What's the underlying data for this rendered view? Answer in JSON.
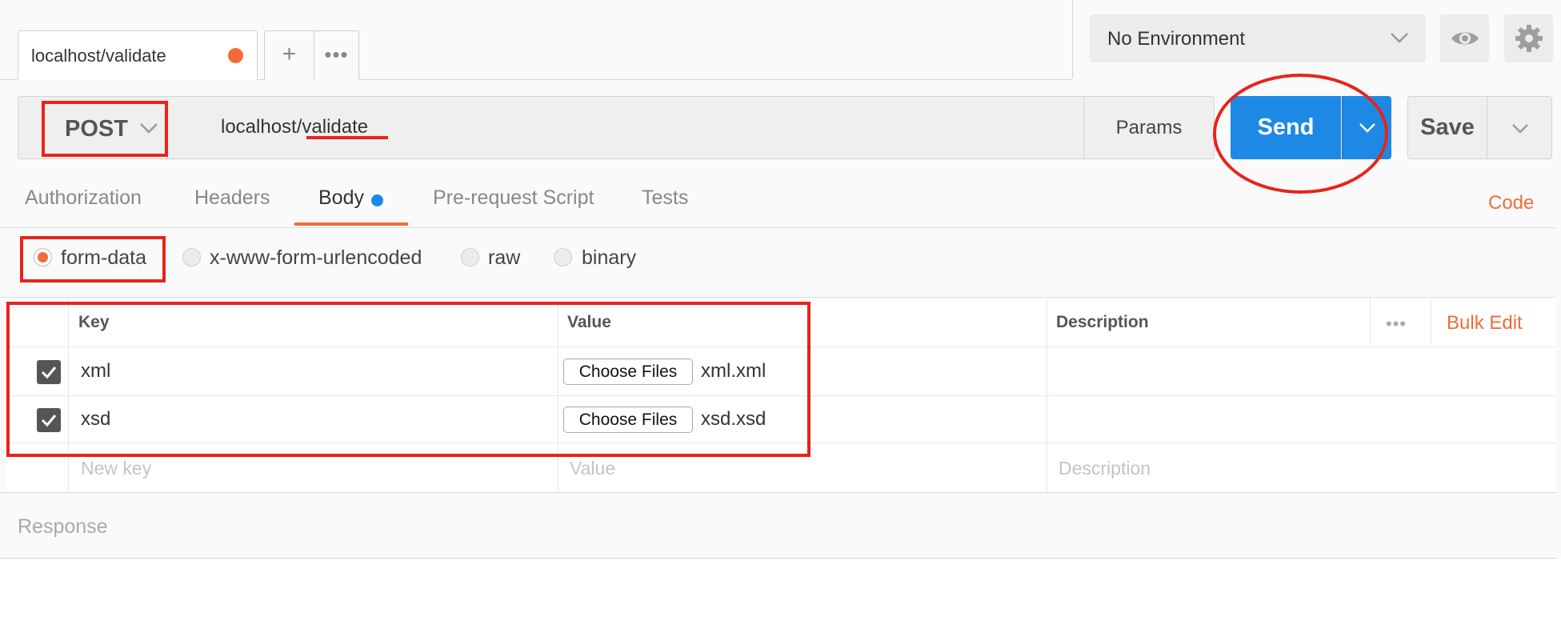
{
  "tabs": {
    "active_label": "localhost/validate",
    "add_label": "+",
    "more_label": "•••"
  },
  "environment": {
    "selected": "No Environment"
  },
  "request": {
    "method": "POST",
    "url": "localhost/validate",
    "params_label": "Params",
    "send_label": "Send",
    "save_label": "Save"
  },
  "subtabs": {
    "items": [
      "Authorization",
      "Headers",
      "Body",
      "Pre-request Script",
      "Tests"
    ],
    "active": "Body",
    "code_label": "Code"
  },
  "body_types": {
    "options": [
      "form-data",
      "x-www-form-urlencoded",
      "raw",
      "binary"
    ],
    "selected": "form-data"
  },
  "table": {
    "headers": {
      "key": "Key",
      "value": "Value",
      "description": "Description",
      "more": "•••",
      "bulk_edit": "Bulk Edit"
    },
    "rows": [
      {
        "checked": true,
        "key": "xml",
        "button": "Choose Files",
        "file": "xml.xml"
      },
      {
        "checked": true,
        "key": "xsd",
        "button": "Choose Files",
        "file": "xsd.xsd"
      }
    ],
    "placeholders": {
      "key": "New key",
      "value": "Value",
      "description": "Description"
    }
  },
  "response": {
    "label": "Response"
  },
  "colors": {
    "accent_orange": "#f26b3a",
    "send_blue": "#1e88e5",
    "annotation_red": "#e8231b"
  },
  "icons": [
    "chevron-down-icon",
    "eye-icon",
    "gear-icon",
    "checkbox-checked-icon",
    "more-icon",
    "plus-icon"
  ]
}
